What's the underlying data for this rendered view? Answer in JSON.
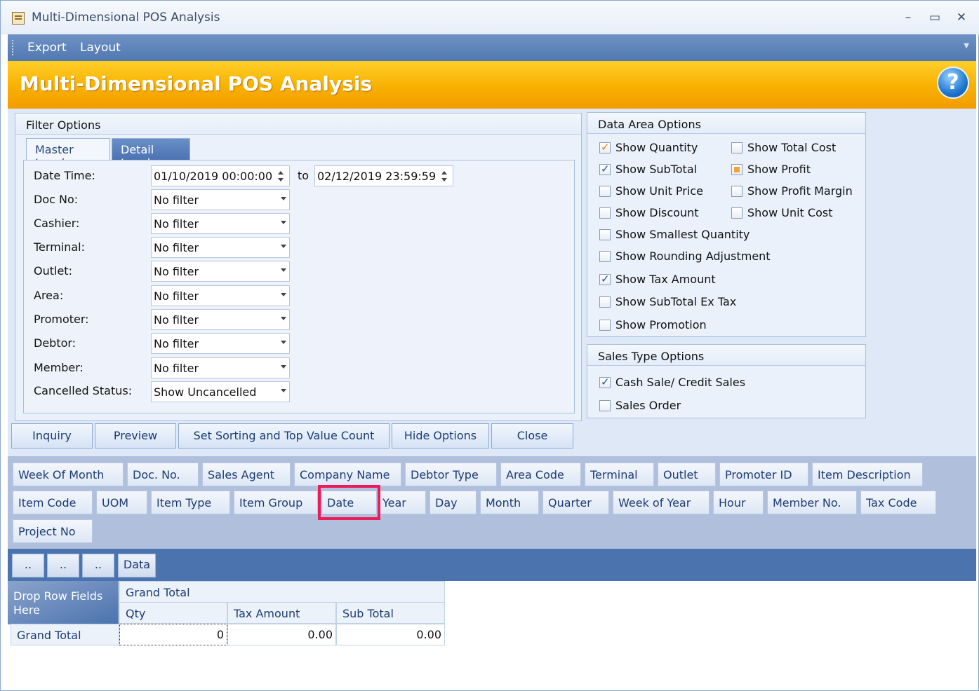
{
  "window": {
    "title": "Multi-Dimensional POS Analysis",
    "controls": {
      "minimize": "–",
      "maximize": "▭",
      "close": "✕"
    }
  },
  "menu": {
    "items": [
      "Export",
      "Layout"
    ]
  },
  "header": {
    "title": "Multi-Dimensional POS Analysis",
    "help": "?"
  },
  "filter_options": {
    "title": "Filter Options",
    "tabs": [
      "Master Level",
      "Detail Level"
    ],
    "date_time": {
      "label": "Date Time:",
      "from": "01/10/2019 00:00:00",
      "to_label": "to",
      "to": "02/12/2019 23:59:59"
    },
    "fields": [
      {
        "label": "Doc No:",
        "value": "No filter"
      },
      {
        "label": "Cashier:",
        "value": "No filter"
      },
      {
        "label": "Terminal:",
        "value": "No filter"
      },
      {
        "label": "Outlet:",
        "value": "No filter"
      },
      {
        "label": "Area:",
        "value": "No filter"
      },
      {
        "label": "Promoter:",
        "value": "No filter"
      },
      {
        "label": "Debtor:",
        "value": "No filter"
      },
      {
        "label": "Member:",
        "value": "No filter"
      },
      {
        "label": "Cancelled Status:",
        "value": "Show Uncancelled"
      }
    ]
  },
  "data_area_options": {
    "title": "Data Area Options",
    "items": [
      {
        "label": "Show Quantity",
        "state": "checked-orange"
      },
      {
        "label": "Show SubTotal",
        "state": "checked"
      },
      {
        "label": "Show Unit Price",
        "state": "unchecked"
      },
      {
        "label": "Show Discount",
        "state": "unchecked"
      },
      {
        "label": "Show Smallest Quantity",
        "state": "unchecked"
      },
      {
        "label": "Show Rounding Adjustment",
        "state": "unchecked"
      },
      {
        "label": "Show Tax Amount",
        "state": "checked"
      },
      {
        "label": "Show SubTotal Ex Tax",
        "state": "unchecked"
      },
      {
        "label": "Show Promotion",
        "state": "unchecked"
      },
      {
        "label": "Show Total Cost",
        "state": "unchecked"
      },
      {
        "label": "Show Profit",
        "state": "indeterminate"
      },
      {
        "label": "Show Profit Margin",
        "state": "unchecked"
      },
      {
        "label": "Show Unit Cost",
        "state": "unchecked"
      }
    ]
  },
  "sales_type_options": {
    "title": "Sales Type Options",
    "items": [
      {
        "label": "Cash Sale/ Credit Sales",
        "state": "checked"
      },
      {
        "label": "Sales Order",
        "state": "unchecked"
      }
    ]
  },
  "actions": [
    "Inquiry",
    "Preview",
    "Set Sorting and Top Value Count",
    "Hide Options",
    "Close"
  ],
  "field_list": [
    "Week Of Month",
    "Doc. No.",
    "Sales Agent",
    "Company Name",
    "Debtor Type",
    "Area Code",
    "Terminal",
    "Outlet",
    "Promoter ID",
    "Item Description",
    "Item Code",
    "UOM",
    "Item Type",
    "Item Group",
    "Date",
    "Year",
    "Day",
    "Month",
    "Quarter",
    "Week of Year",
    "Hour",
    "Member No.",
    "Tax Code",
    "Project No"
  ],
  "highlighted_field": "Date",
  "pivot": {
    "header_buttons": [
      "..",
      "..",
      "..",
      "Data"
    ],
    "row_drop": "Drop Row Fields Here",
    "column_header": "Grand Total",
    "data_columns": [
      "Qty",
      "Tax Amount",
      "Sub Total"
    ],
    "row_label": "Grand Total",
    "values": [
      "0",
      "0.00",
      "0.00"
    ]
  },
  "colors": {
    "banner": "#f8b000",
    "menubar": "#5178b1",
    "highlight": "#ec1c5b"
  }
}
